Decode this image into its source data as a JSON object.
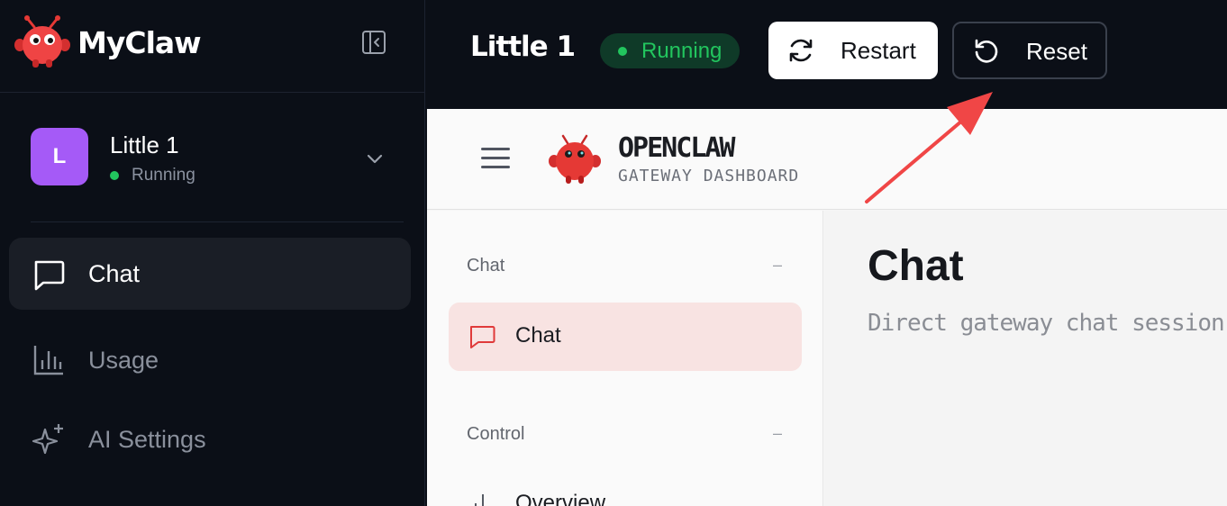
{
  "app": {
    "brand_name": "MyClaw",
    "accent": "#ef4444",
    "background": "#0b0f17"
  },
  "sidebar": {
    "agent": {
      "avatar_letter": "L",
      "avatar_color": "#a55af7",
      "name": "Little 1",
      "status": "Running"
    },
    "items": [
      {
        "label": "Chat",
        "icon": "chat-bubble-icon",
        "active": true
      },
      {
        "label": "Usage",
        "icon": "bar-chart-icon",
        "active": false
      },
      {
        "label": "AI Settings",
        "icon": "sparkles-icon",
        "active": false
      }
    ]
  },
  "topbar": {
    "instance_title": "Little 1",
    "status": "Running",
    "status_color": "#22c55e",
    "restart_label": "Restart",
    "reset_label": "Reset"
  },
  "gateway": {
    "title": "OPENCLAW",
    "subtitle": "GATEWAY DASHBOARD",
    "nav": {
      "sections": [
        {
          "label": "Chat",
          "toggle": "–",
          "items": [
            {
              "label": "Chat",
              "icon": "chat-bubble-icon",
              "active": true
            }
          ]
        },
        {
          "label": "Control",
          "toggle": "–",
          "items": [
            {
              "label": "Overview",
              "icon": "bar-chart-icon",
              "active": false
            }
          ]
        }
      ]
    },
    "main": {
      "title": "Chat",
      "description": "Direct gateway chat session fo"
    }
  },
  "annotation": {
    "arrow_color": "#f04646",
    "points_to": "reset-button"
  }
}
